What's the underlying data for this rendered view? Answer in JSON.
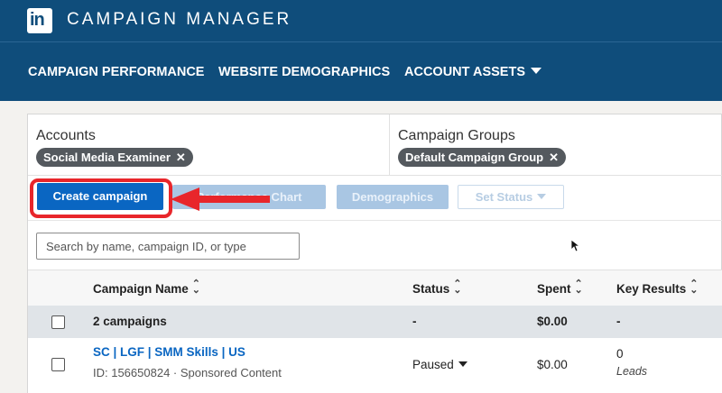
{
  "app": {
    "logo_text": "in",
    "title": "CAMPAIGN MANAGER"
  },
  "nav": {
    "items": [
      {
        "label": "CAMPAIGN PERFORMANCE"
      },
      {
        "label": "WEBSITE DEMOGRAPHICS"
      },
      {
        "label": "ACCOUNT ASSETS"
      }
    ]
  },
  "filters": {
    "accounts": {
      "label": "Accounts",
      "chip": "Social Media Examiner"
    },
    "groups": {
      "label": "Campaign Groups",
      "chip": "Default Campaign Group"
    }
  },
  "toolbar": {
    "create_label": "Create campaign",
    "chart_label": "Performance Chart",
    "demographics_label": "Demographics",
    "status_label": "Set Status"
  },
  "search": {
    "placeholder": "Search by name, campaign ID, or type"
  },
  "table": {
    "headers": {
      "name": "Campaign Name",
      "status": "Status",
      "spent": "Spent",
      "results": "Key Results"
    },
    "summary": {
      "label": "2 campaigns",
      "status": "-",
      "spent": "$0.00",
      "results": "-"
    },
    "rows": [
      {
        "name": "SC | LGF | SMM Skills | US",
        "meta": "ID: 156650824 · Sponsored Content",
        "status": "Paused",
        "spent": "$0.00",
        "results_value": "0",
        "results_label": "Leads"
      }
    ]
  },
  "colors": {
    "header_bg": "#0f4d7b",
    "primary": "#0a66c2",
    "annotation": "#e8262b"
  },
  "icons": {
    "close": "x-icon",
    "sort": "sort-arrows-icon",
    "caret": "caret-down-icon"
  }
}
